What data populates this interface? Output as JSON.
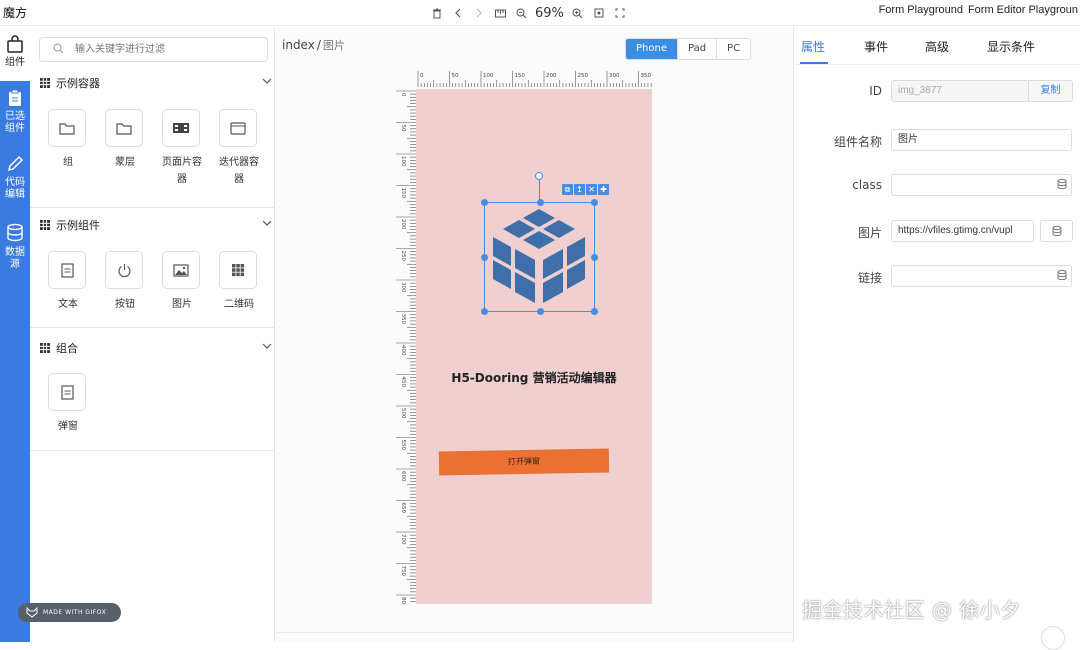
{
  "app": {
    "title": "魔方"
  },
  "toolbar": {
    "zoom": "69%"
  },
  "top_links": [
    "Form Playground",
    "Form Editor Playgroun"
  ],
  "left_nav": [
    {
      "label_1": "组件",
      "label_2": "",
      "icon": "bag-icon"
    },
    {
      "label_1": "已选",
      "label_2": "组件",
      "icon": "clipboard-icon"
    },
    {
      "label_1": "代码",
      "label_2": "编辑",
      "icon": "pencil-icon"
    },
    {
      "label_1": "数据",
      "label_2": "源",
      "icon": "database-icon"
    }
  ],
  "components_panel": {
    "search_placeholder": "输入关键字进行过滤",
    "sections": [
      {
        "title": "示例容器",
        "items": [
          {
            "label": "组",
            "icon": "folder-icon"
          },
          {
            "label": "蒙层",
            "icon": "folder-icon"
          },
          {
            "label": "页面片容器",
            "icon": "film-icon"
          },
          {
            "label": "迭代器容器",
            "icon": "window-icon"
          }
        ]
      },
      {
        "title": "示例组件",
        "items": [
          {
            "label": "文本",
            "icon": "document-icon"
          },
          {
            "label": "按钮",
            "icon": "power-icon"
          },
          {
            "label": "图片",
            "icon": "image-icon"
          },
          {
            "label": "二维码",
            "icon": "grid-icon"
          }
        ]
      },
      {
        "title": "组合",
        "items": [
          {
            "label": "弹窗",
            "icon": "document-icon"
          }
        ]
      }
    ]
  },
  "canvas": {
    "breadcrumb_root": "index",
    "breadcrumb_current": "图片",
    "devices": [
      "Phone",
      "Pad",
      "PC"
    ],
    "active_device": "Phone",
    "ruler_top": [
      "0",
      "50",
      "100",
      "150",
      "200",
      "250",
      "300",
      "350"
    ],
    "ruler_left": [
      "0",
      "50",
      "100",
      "150",
      "200",
      "250",
      "300",
      "350",
      "400",
      "450",
      "500",
      "550",
      "600",
      "650",
      "700",
      "750",
      "800"
    ],
    "page_title": "H5-Dooring 营销活动编辑器",
    "button_text": "打开弹窗"
  },
  "props_panel": {
    "tabs": [
      "属性",
      "事件",
      "高级",
      "显示条件"
    ],
    "active_tab": "属性",
    "id_label": "ID",
    "id_value": "img_3877",
    "copy_label": "复制",
    "name_label": "组件名称",
    "name_value": "图片",
    "class_label": "class",
    "class_value": "",
    "image_label": "图片",
    "image_value": "https://vfiles.gtimg.cn/vupl",
    "link_label": "链接",
    "link_value": ""
  },
  "overlays": {
    "watermark": "掘金技术社区 @ 徐小夕",
    "gifox": "MADE WITH GIFOX"
  },
  "colors": {
    "accent": "#3a7be0",
    "phone_bg": "#efcfd0",
    "button_bg": "#ea7132",
    "cube": "#3e6fa8"
  }
}
